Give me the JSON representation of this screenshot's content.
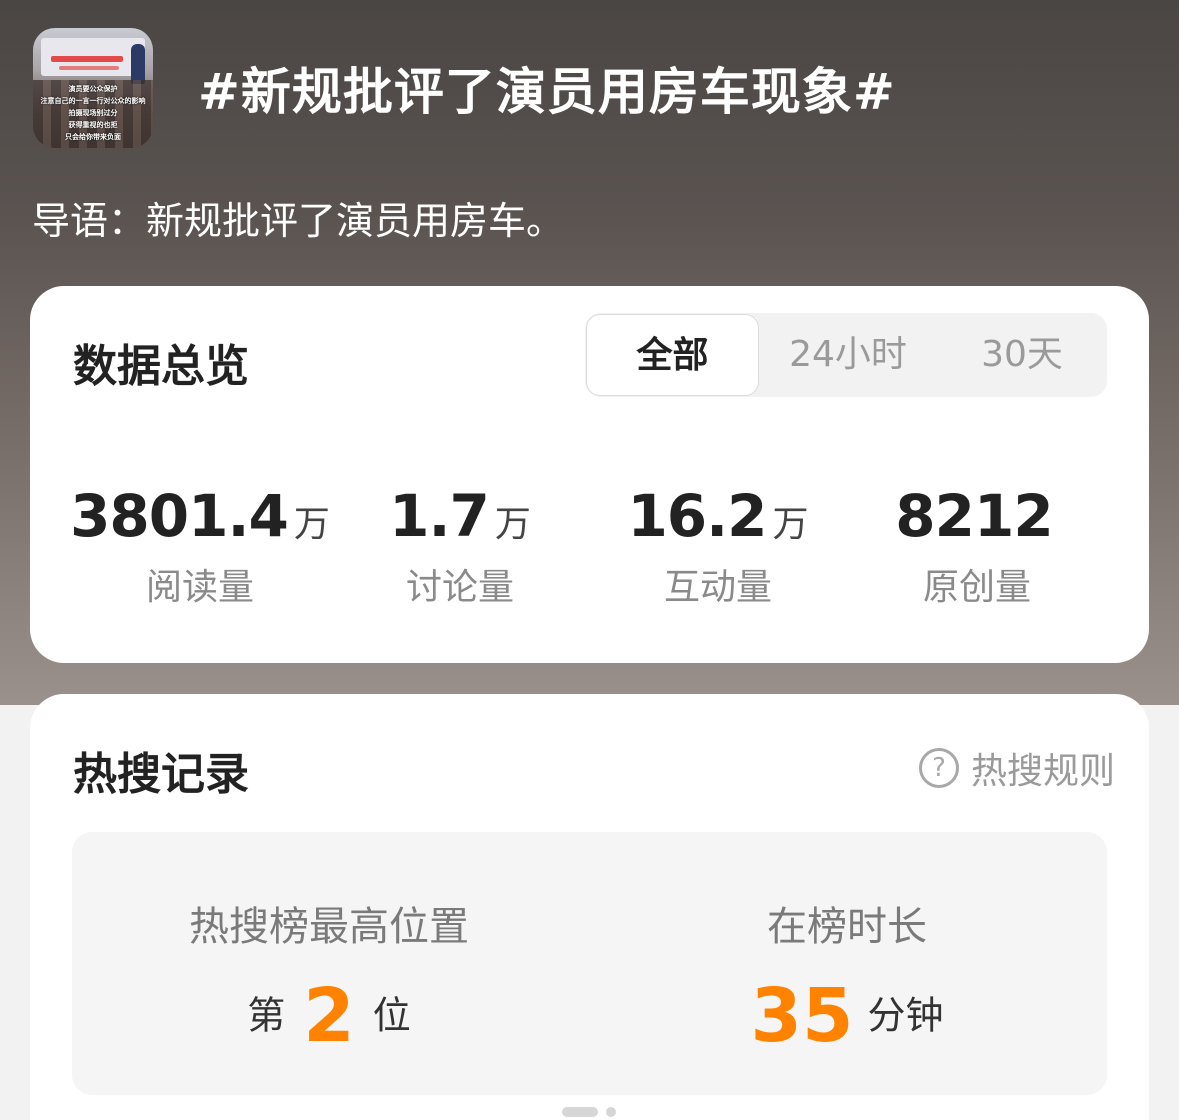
{
  "header": {
    "title": "#新规批评了演员用房车现象#",
    "intro": "导语：新规批评了演员用房车。",
    "thumbnail_captions": [
      "演员要公众保护",
      "注意自己的一言一行对公众的影响",
      "拍摄现场别过分",
      "获得重视的也拒",
      "只会给你带来负面"
    ]
  },
  "overview": {
    "title": "数据总览",
    "tabs": [
      "全部",
      "24小时",
      "30天"
    ],
    "active_tab": "全部",
    "stats": [
      {
        "value": "3801.4",
        "unit": "万",
        "label": "阅读量"
      },
      {
        "value": "1.7",
        "unit": "万",
        "label": "讨论量"
      },
      {
        "value": "16.2",
        "unit": "万",
        "label": "互动量"
      },
      {
        "value": "8212",
        "unit": "",
        "label": "原创量"
      }
    ]
  },
  "hot": {
    "title": "热搜记录",
    "rules_label": "热搜规则",
    "help_glyph": "?",
    "highest": {
      "label": "热搜榜最高位置",
      "prefix": "第",
      "value": "2",
      "suffix": "位"
    },
    "duration": {
      "label": "在榜时长",
      "value": "35",
      "unit": "分钟"
    }
  },
  "colors": {
    "accent": "#ff8200",
    "card": "#ffffff",
    "muted": "#9a9a9a"
  }
}
